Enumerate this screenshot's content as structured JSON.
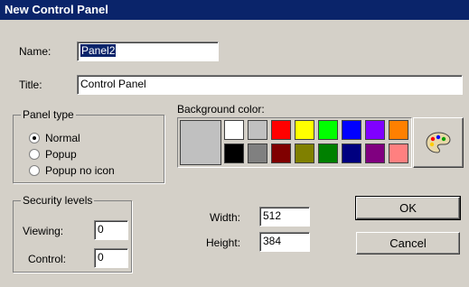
{
  "dialog": {
    "title": "New Control Panel"
  },
  "name": {
    "label": "Name:",
    "value": "Panel2"
  },
  "title_field": {
    "label": "Title:",
    "value": "Control Panel"
  },
  "panel_type": {
    "label": "Panel type",
    "options": [
      {
        "label": "Normal",
        "selected": true
      },
      {
        "label": "Popup",
        "selected": false
      },
      {
        "label": "Popup no icon",
        "selected": false
      }
    ]
  },
  "background": {
    "label": "Background color:",
    "current_color": "#c0c0c0",
    "colors": [
      "#ffffff",
      "#c0c0c0",
      "#ff0000",
      "#ffff00",
      "#00ff00",
      "#0000ff",
      "#8000ff",
      "#ff8000",
      "#000000",
      "#808080",
      "#800000",
      "#808000",
      "#008000",
      "#000080",
      "#800080",
      "#ff8080"
    ],
    "palette_icon": "palette-icon"
  },
  "security": {
    "label": "Security levels",
    "viewing": {
      "label": "Viewing:",
      "value": "0"
    },
    "control": {
      "label": "Control:",
      "value": "0"
    }
  },
  "size": {
    "width": {
      "label": "Width:",
      "value": "512"
    },
    "height": {
      "label": "Height:",
      "value": "384"
    }
  },
  "buttons": {
    "ok": "OK",
    "cancel": "Cancel"
  }
}
